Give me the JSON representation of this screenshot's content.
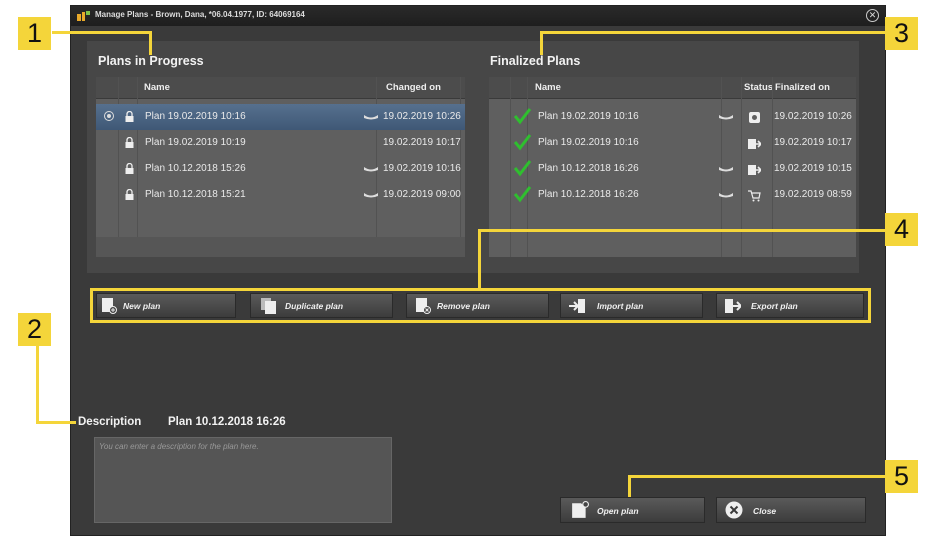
{
  "window": {
    "title": "Manage Plans - Brown, Dana, *06.04.1977, ID: 64069164",
    "close": "⊗"
  },
  "plans_in_progress": {
    "title": "Plans in Progress",
    "columns": {
      "name": "Name",
      "changed_on": "Changed on"
    },
    "rows": [
      {
        "name": "Plan 19.02.2019 10:16",
        "changed_on": "19.02.2019 10:26",
        "selected": true,
        "has_tooth": true
      },
      {
        "name": "Plan 19.02.2019 10:19",
        "changed_on": "19.02.2019 10:17",
        "selected": false,
        "has_tooth": false
      },
      {
        "name": "Plan 10.12.2018 15:26",
        "changed_on": "19.02.2019 10:16",
        "selected": false,
        "has_tooth": true
      },
      {
        "name": "Plan 10.12.2018 15:21",
        "changed_on": "19.02.2019 09:00",
        "selected": false,
        "has_tooth": true
      }
    ]
  },
  "finalized_plans": {
    "title": "Finalized Plans",
    "columns": {
      "name": "Name",
      "status": "Status",
      "finalized_on": "Finalized on"
    },
    "rows": [
      {
        "name": "Plan 19.02.2019 10:16",
        "finalized_on": "19.02.2019 10:26",
        "status_icon": "guide-icon",
        "has_tooth": true
      },
      {
        "name": "Plan 19.02.2019 10:16",
        "finalized_on": "19.02.2019 10:17",
        "status_icon": "export-icon",
        "has_tooth": false
      },
      {
        "name": "Plan 10.12.2018 16:26",
        "finalized_on": "19.02.2019 10:15",
        "status_icon": "export-icon",
        "has_tooth": true
      },
      {
        "name": "Plan 10.12.2018 16:26",
        "finalized_on": "19.02.2019 08:59",
        "status_icon": "cart-icon",
        "has_tooth": true
      }
    ]
  },
  "toolbar": {
    "new_plan": "New plan",
    "duplicate_plan": "Duplicate plan",
    "remove_plan": "Remove plan",
    "import_plan": "Import plan",
    "export_plan": "Export plan"
  },
  "description": {
    "label": "Description",
    "plan_name": "Plan 10.12.2018 16:26",
    "placeholder": "You can enter a description for the plan here."
  },
  "footer": {
    "open_plan": "Open plan",
    "close": "Close"
  },
  "callouts": [
    "1",
    "2",
    "3",
    "4",
    "5"
  ],
  "colors": {
    "callout": "#f4d53a",
    "selection": "#4a6585",
    "check": "#2fbf2f"
  }
}
